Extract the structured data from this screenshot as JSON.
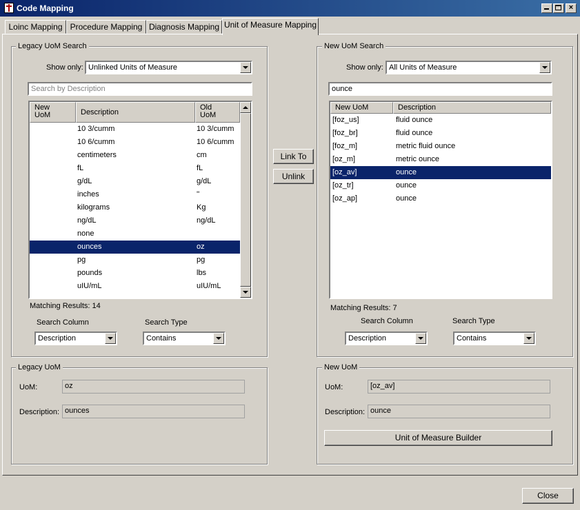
{
  "window": {
    "title": "Code Mapping"
  },
  "tabs": [
    {
      "label": "Loinc Mapping"
    },
    {
      "label": "Procedure  Mapping"
    },
    {
      "label": "Diagnosis Mapping"
    },
    {
      "label": "Unit of Measure Mapping"
    }
  ],
  "legacy_search": {
    "title": "Legacy UoM Search",
    "show_only_label": "Show only:",
    "show_only_value": "Unlinked Units of Measure",
    "search_placeholder": "Search by Description",
    "columns": [
      "New UoM",
      "Description",
      "Old UoM"
    ],
    "rows": [
      {
        "new": "",
        "desc": "10 3/cumm",
        "old": "10 3/cumm"
      },
      {
        "new": "",
        "desc": "10 6/cumm",
        "old": "10 6/cumm"
      },
      {
        "new": "",
        "desc": "centimeters",
        "old": "cm"
      },
      {
        "new": "",
        "desc": "fL",
        "old": "fL"
      },
      {
        "new": "",
        "desc": "g/dL",
        "old": "g/dL"
      },
      {
        "new": "",
        "desc": "inches",
        "old": "''"
      },
      {
        "new": "",
        "desc": "kilograms",
        "old": "Kg"
      },
      {
        "new": "",
        "desc": "ng/dL",
        "old": "ng/dL"
      },
      {
        "new": "",
        "desc": "none",
        "old": ""
      },
      {
        "new": "",
        "desc": "ounces",
        "old": "oz"
      },
      {
        "new": "",
        "desc": "pg",
        "old": "pg"
      },
      {
        "new": "",
        "desc": "pounds",
        "old": "lbs"
      },
      {
        "new": "",
        "desc": "uIU/mL",
        "old": "uIU/mL"
      }
    ],
    "selected_index": 9,
    "matching_results": "Matching Results: 14",
    "search_column_label": "Search Column",
    "search_column_value": "Description",
    "search_type_label": "Search Type",
    "search_type_value": "Contains"
  },
  "new_search": {
    "title": "New UoM Search",
    "show_only_label": "Show only:",
    "show_only_value": "All Units of Measure",
    "search_value": "ounce",
    "columns": [
      "New UoM",
      "Description"
    ],
    "rows": [
      {
        "new": "[foz_us]",
        "desc": "fluid ounce"
      },
      {
        "new": "[foz_br]",
        "desc": "fluid ounce"
      },
      {
        "new": "[foz_m]",
        "desc": "metric fluid ounce"
      },
      {
        "new": "[oz_m]",
        "desc": "metric ounce"
      },
      {
        "new": "[oz_av]",
        "desc": "ounce"
      },
      {
        "new": "[oz_tr]",
        "desc": "ounce"
      },
      {
        "new": "[oz_ap]",
        "desc": "ounce"
      }
    ],
    "selected_index": 4,
    "matching_results": "Matching Results: 7",
    "search_column_label": "Search Column",
    "search_column_value": "Description",
    "search_type_label": "Search Type",
    "search_type_value": "Contains"
  },
  "actions": {
    "link_to": "Link To",
    "unlink": "Unlink"
  },
  "legacy_uom": {
    "title": "Legacy UoM",
    "uom_label": "UoM:",
    "uom_value": "oz",
    "desc_label": "Description:",
    "desc_value": "ounces"
  },
  "new_uom": {
    "title": "New UoM",
    "uom_label": "UoM:",
    "uom_value": "[oz_av]",
    "desc_label": "Description:",
    "desc_value": "ounce",
    "builder_button": "Unit of Measure Builder"
  },
  "footer": {
    "close": "Close"
  }
}
